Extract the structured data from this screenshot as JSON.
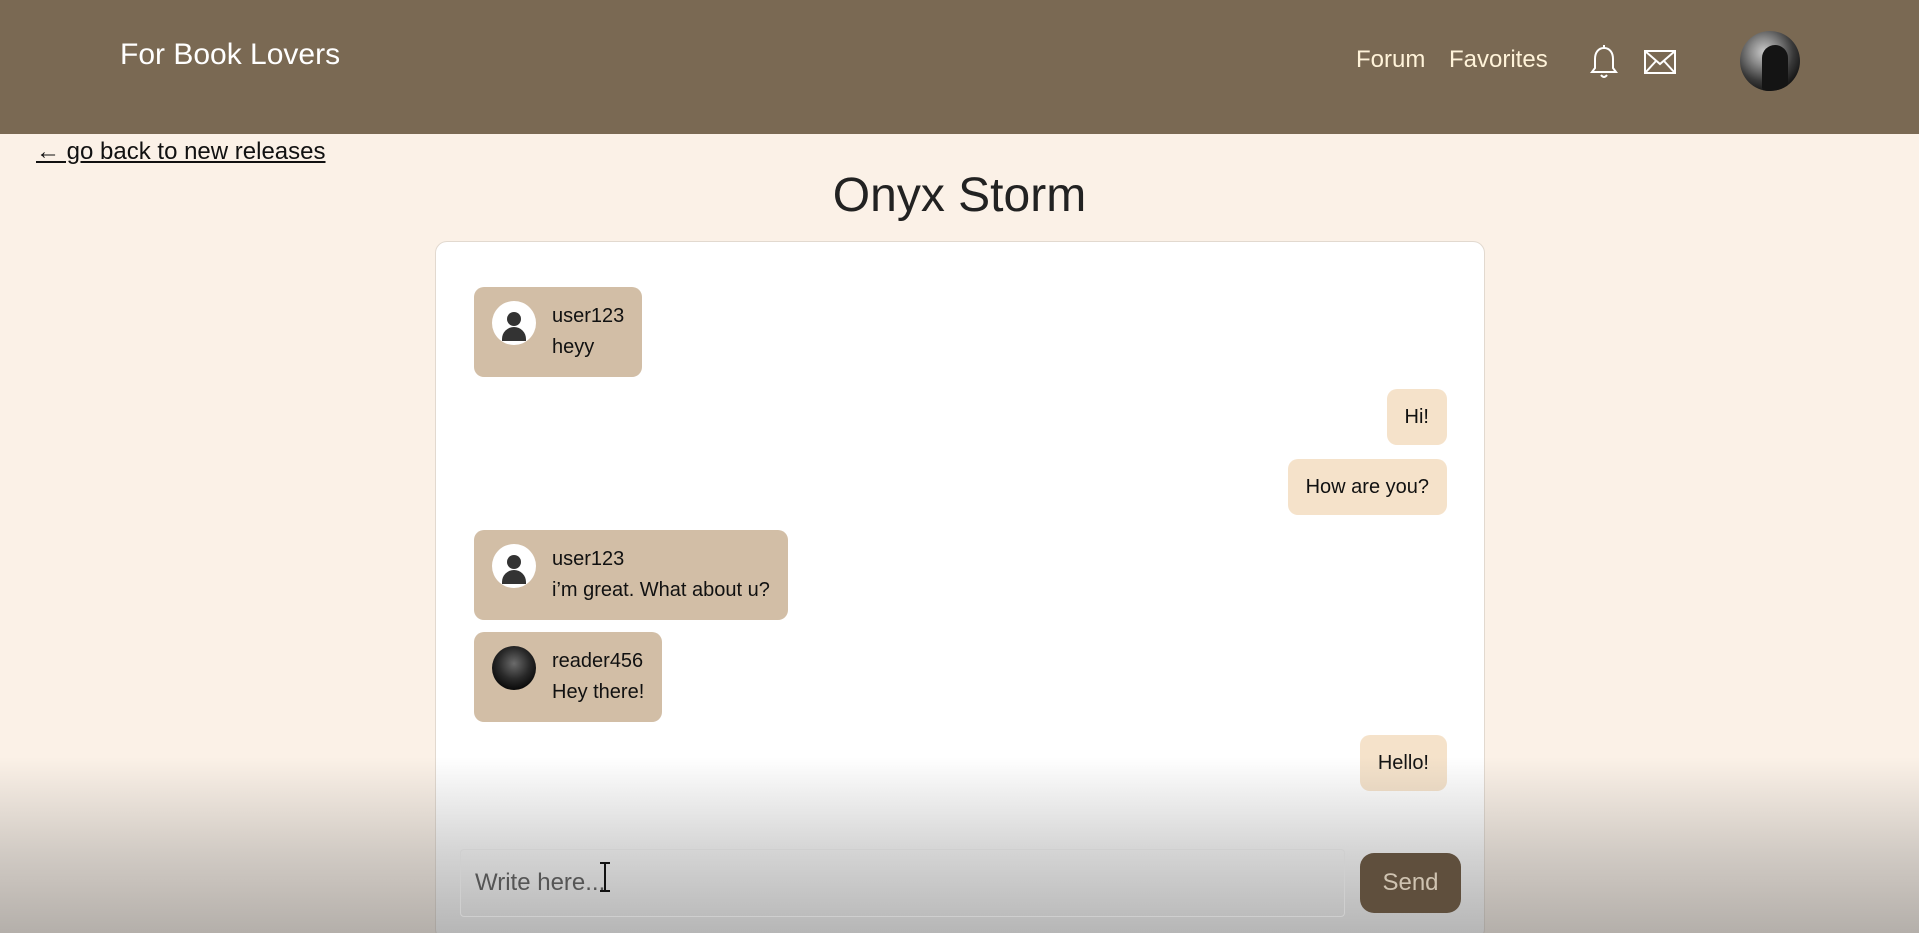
{
  "header": {
    "brand": "For Book Lovers",
    "nav": {
      "forum": "Forum",
      "favorites": "Favorites"
    },
    "icons": [
      "bell-icon",
      "mail-icon"
    ],
    "color": "#7a6953"
  },
  "back_link": "← go back to new releases",
  "page_title": "Onyx Storm",
  "messages": [
    {
      "direction": "in",
      "user": "user123",
      "text": "heyy",
      "avatar": "default"
    },
    {
      "direction": "out",
      "text": "Hi!"
    },
    {
      "direction": "out",
      "text": "How are you?"
    },
    {
      "direction": "in",
      "user": "user123",
      "text": "i’m great. What about u?",
      "avatar": "default"
    },
    {
      "direction": "in",
      "user": "reader456",
      "text": "Hey there!",
      "avatar": "photo"
    },
    {
      "direction": "out",
      "text": "Hello!"
    }
  ],
  "composer": {
    "placeholder": "Write here...",
    "send_label": "Send"
  },
  "colors": {
    "incoming": "#d2bea6",
    "outgoing": "#f5e2ca",
    "send": "#5f4f3d",
    "page": "#fbf1e7"
  }
}
